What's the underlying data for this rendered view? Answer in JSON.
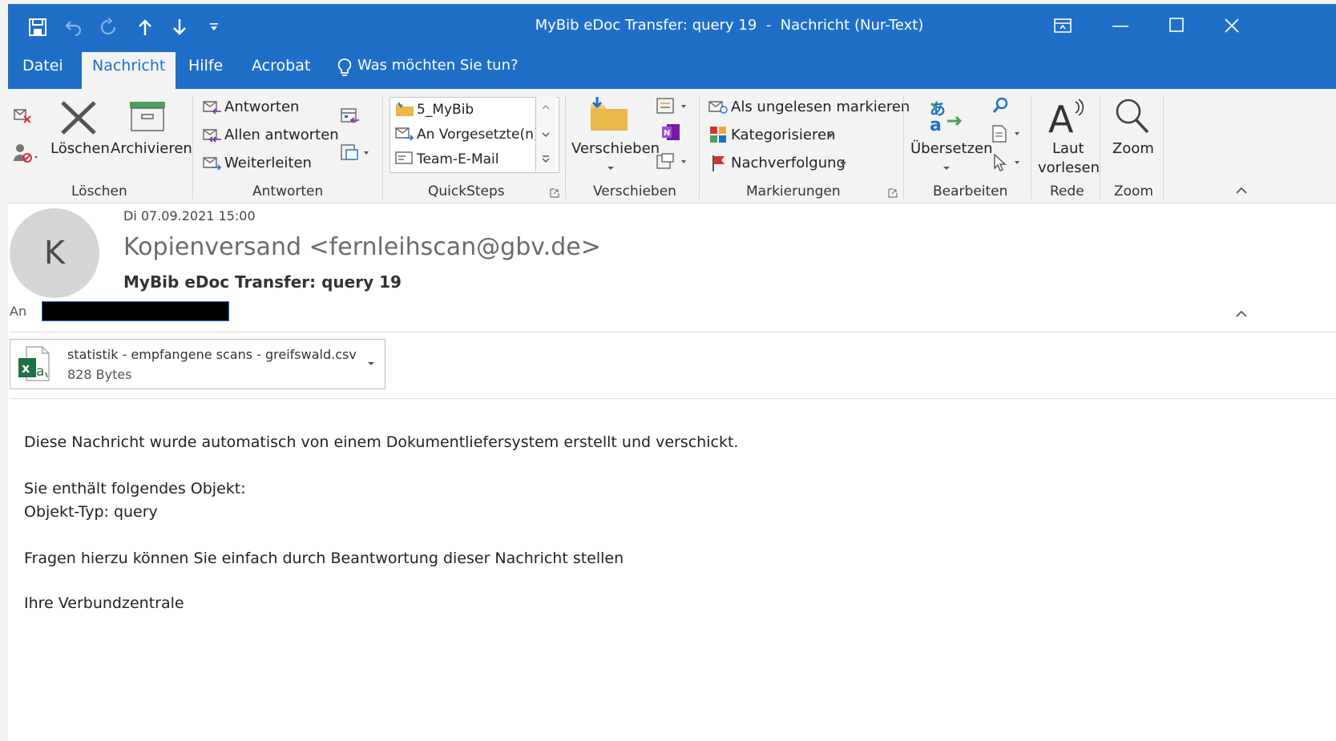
{
  "window": {
    "title": "MyBib eDoc Transfer: query 19  -  Nachricht (Nur-Text)"
  },
  "menu": {
    "datei": "Datei",
    "nachricht": "Nachricht",
    "hilfe": "Hilfe",
    "acrobat": "Acrobat",
    "search_prompt": "Was möchten Sie tun?"
  },
  "ribbon": {
    "loeschen_group": {
      "label": "Löschen",
      "delete": "Löschen",
      "archive": "Archivieren"
    },
    "antworten_group": {
      "label": "Antworten",
      "reply": "Antworten",
      "reply_all": "Allen antworten",
      "forward": "Weiterleiten"
    },
    "quicksteps_group": {
      "label": "QuickSteps",
      "items": [
        "5_MyBib",
        "An Vorgesetzte(n)",
        "Team-E-Mail"
      ]
    },
    "verschieben_group": {
      "label": "Verschieben",
      "move": "Verschieben"
    },
    "markierungen_group": {
      "label": "Markierungen",
      "mark_unread": "Als ungelesen markieren",
      "categorize": "Kategorisieren",
      "followup": "Nachverfolgung"
    },
    "bearbeiten_group": {
      "label": "Bearbeiten",
      "translate": "Übersetzen"
    },
    "rede_group": {
      "label": "Rede",
      "read_aloud_line1": "Laut",
      "read_aloud_line2": "vorlesen"
    },
    "zoom_group": {
      "label": "Zoom",
      "zoom": "Zoom"
    }
  },
  "message": {
    "date": "Di 07.09.2021 15:00",
    "avatar_letter": "K",
    "sender": "Kopienversand <fernleihscan@gbv.de>",
    "subject": "MyBib eDoc Transfer: query 19",
    "to_label": "An",
    "attachment": {
      "name": "statistik - empfangene scans - greifswald.csv",
      "size": "828 Bytes"
    },
    "body": [
      "Diese Nachricht wurde automatisch von einem Dokumentliefersystem erstellt und verschickt.",
      "Sie enthält folgendes Objekt:",
      "Objekt-Typ: query",
      "Fragen hierzu können Sie einfach durch Beantwortung dieser Nachricht stellen",
      "Ihre Verbundzentrale"
    ]
  },
  "colors": {
    "accent": "#1f6fc8",
    "ribbon_bg": "#f3f3f3",
    "excel_green": "#1e7145",
    "flag_red": "#d13438"
  }
}
